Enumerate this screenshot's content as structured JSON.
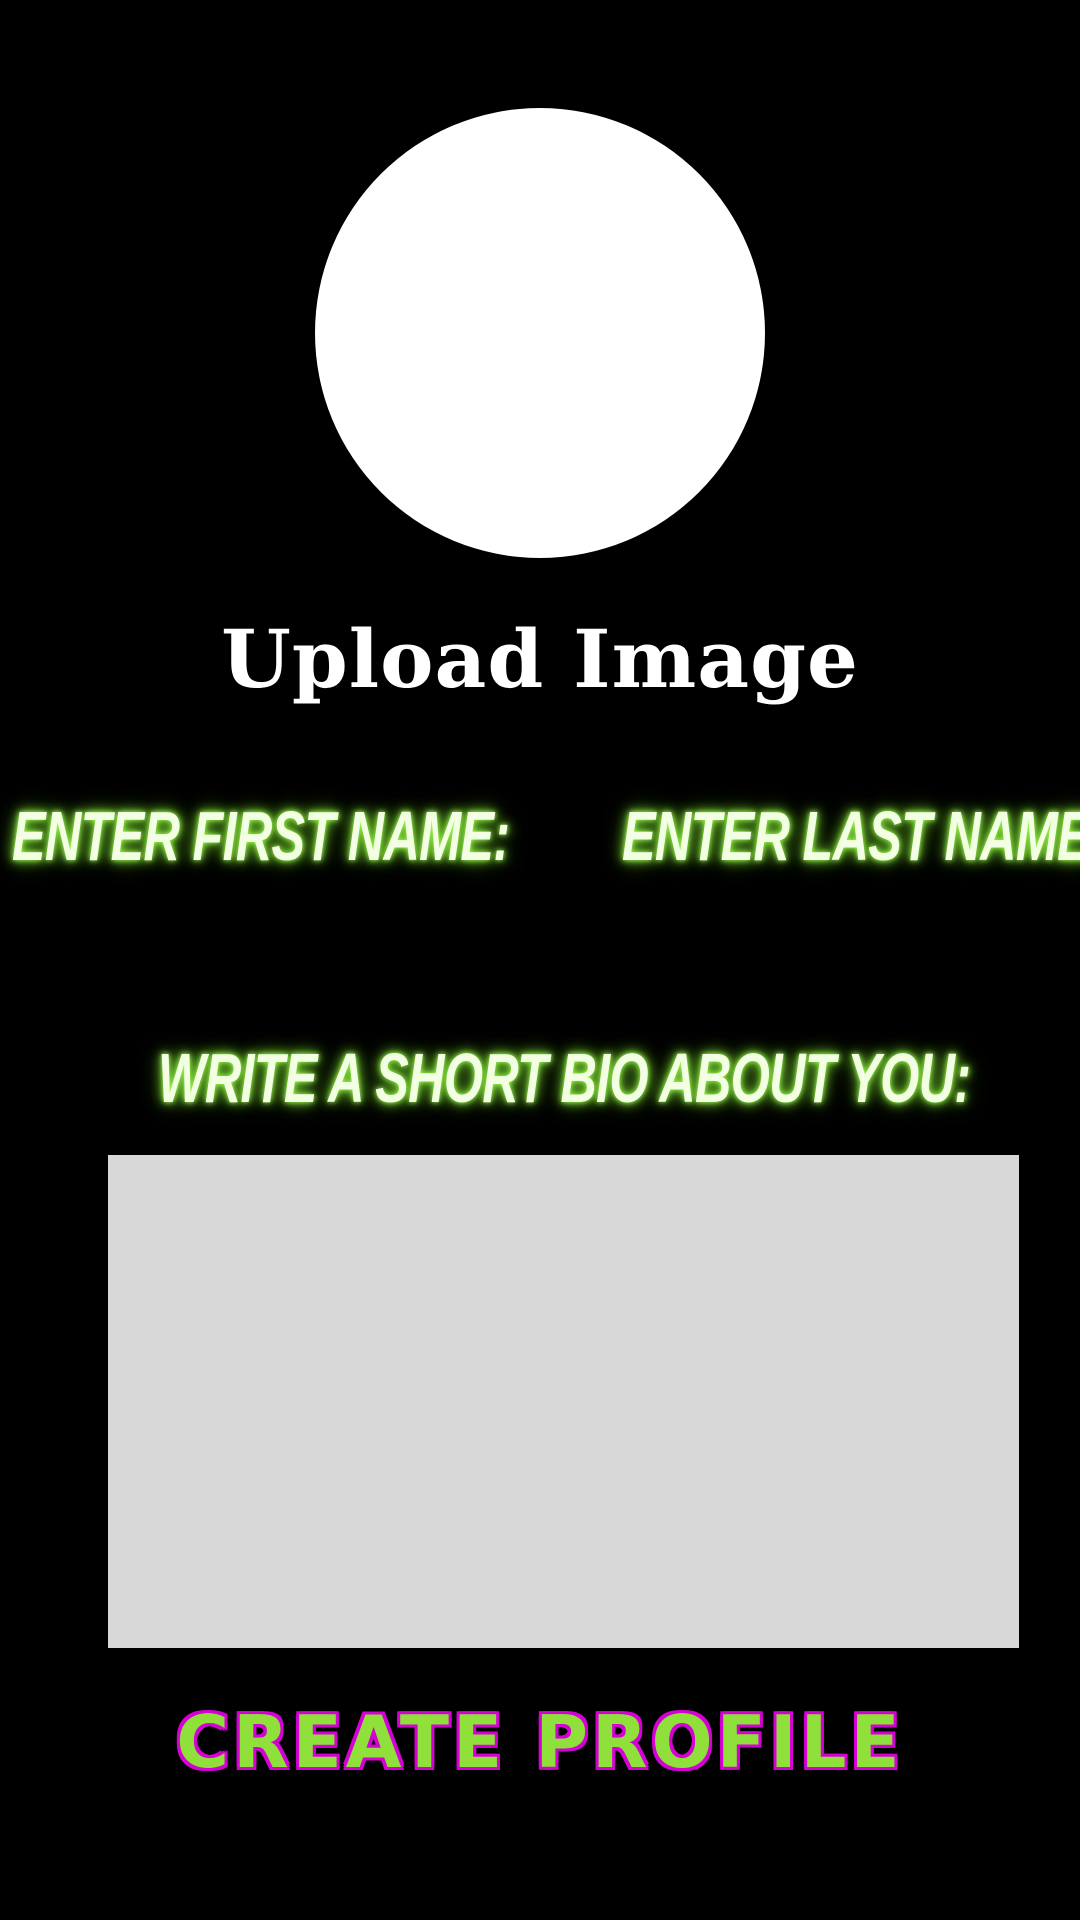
{
  "upload": {
    "label": "Upload Image"
  },
  "fields": {
    "first_name_label": "ENTER FIRST NAME:",
    "last_name_label": "ENTER LAST NAME:",
    "bio_label": "WRITE A SHORT BIO ABOUT YOU:",
    "bio_value": ""
  },
  "actions": {
    "create_label": "CREATE PROFILE"
  },
  "colors": {
    "background": "#000000",
    "glow_accent": "#a6ff5a",
    "button_fill": "#8fe03a",
    "button_outline": "#d400d4",
    "bio_box": "#d9d8d9"
  }
}
